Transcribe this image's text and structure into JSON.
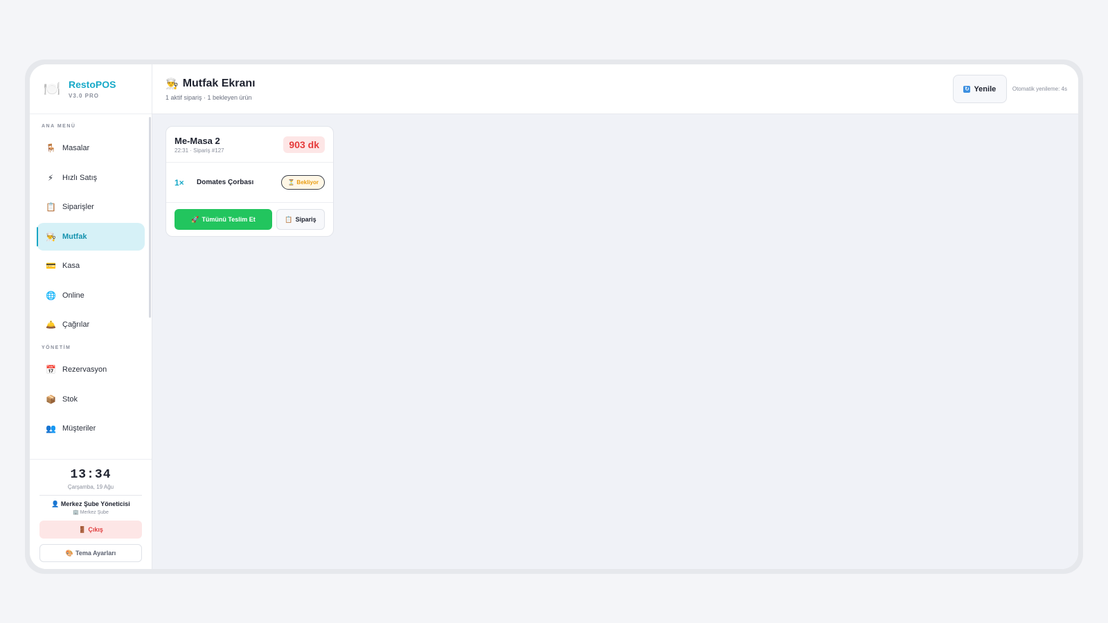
{
  "brand": {
    "logo_icon": "🍽️",
    "name": "RestoPOS",
    "version": "V3.0 PRO"
  },
  "sidebar": {
    "sections": [
      {
        "label": "ANA MENÜ",
        "items": [
          {
            "icon": "🪑",
            "icon_name": "chair-icon",
            "label": "Masalar"
          },
          {
            "icon": "⚡",
            "icon_name": "lightning-icon",
            "label": "Hızlı Satış"
          },
          {
            "icon": "📋",
            "icon_name": "clipboard-icon",
            "label": "Siparişler"
          },
          {
            "icon": "👨‍🍳",
            "icon_name": "chef-icon",
            "label": "Mutfak",
            "active": true
          },
          {
            "icon": "💳",
            "icon_name": "credit-card-icon",
            "label": "Kasa"
          },
          {
            "icon": "🌐",
            "icon_name": "globe-icon",
            "label": "Online"
          },
          {
            "icon": "🛎️",
            "icon_name": "bell-icon",
            "label": "Çağrılar"
          }
        ]
      },
      {
        "label": "YÖNETİM",
        "items": [
          {
            "icon": "📅",
            "icon_name": "calendar-icon",
            "label": "Rezervasyon"
          },
          {
            "icon": "📦",
            "icon_name": "box-icon",
            "label": "Stok"
          },
          {
            "icon": "👥",
            "icon_name": "users-icon",
            "label": "Müşteriler"
          }
        ]
      }
    ],
    "footer": {
      "clock": "13:34",
      "date": "Çarşamba, 19 Ağu",
      "user_icon": "👤",
      "user_name": "Merkez Şube Yöneticisi",
      "branch_icon": "🏢",
      "branch": "Merkez Şube",
      "logout_icon": "🚪",
      "logout_label": "Çıkış",
      "theme_icon": "🎨",
      "theme_label": "Tema Ayarları"
    }
  },
  "header": {
    "title_icon": "👨‍🍳",
    "title": "Mutfak Ekranı",
    "subtitle": "1 aktif sipariş · 1 bekleyen ürün",
    "refresh_icon": "↻",
    "refresh_label": "Yenile",
    "auto_refresh": "Otomatik yenileme: 4s"
  },
  "orders": [
    {
      "table": "Me-Masa 2",
      "meta": "22:31 · Sipariş #127",
      "elapsed": "903 dk",
      "items": [
        {
          "qty": "1×",
          "name": "Domates Çorbası",
          "status_icon": "⏳",
          "status": "Bekliyor"
        }
      ],
      "deliver_icon": "🚀",
      "deliver_label": "Tümünü Teslim Et",
      "order_icon": "📋",
      "order_label": "Sipariş"
    }
  ],
  "colors": {
    "accent": "#17a9c8",
    "active_bg": "#d6f1f7",
    "danger": "#e53a3a",
    "success": "#22c55e",
    "warning": "#e89c10"
  }
}
